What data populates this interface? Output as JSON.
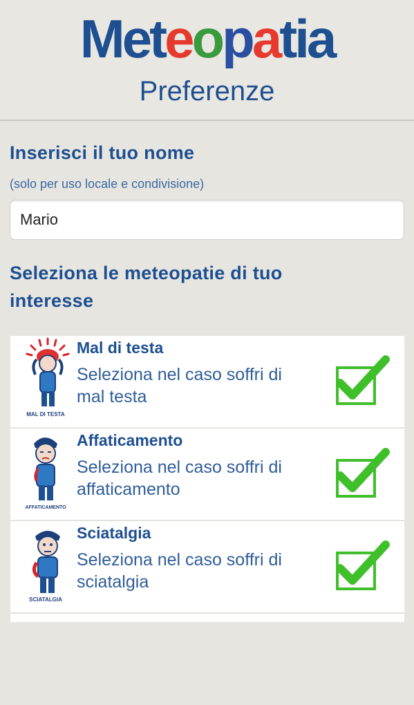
{
  "header": {
    "logo_letters": [
      {
        "char": "M",
        "color": "#1d4f91"
      },
      {
        "char": "e",
        "color": "#1d4f91"
      },
      {
        "char": "t",
        "color": "#1d4f91"
      },
      {
        "char": "e",
        "color": "#e63a2e"
      },
      {
        "char": "o",
        "color": "#3a9a3e"
      },
      {
        "char": "p",
        "color": "#2a4fa0"
      },
      {
        "char": "a",
        "color": "#e63a2e"
      },
      {
        "char": "t",
        "color": "#1d4f91"
      },
      {
        "char": "i",
        "color": "#1d4f91"
      },
      {
        "char": "a",
        "color": "#1d4f91"
      }
    ],
    "subtitle": "Preferenze"
  },
  "name_section": {
    "title": "Inserisci il tuo nome",
    "hint": "(solo per uso locale e condivisione)",
    "value": "Mario"
  },
  "conditions_section": {
    "title_line1": "Seleziona le meteopatie di tuo",
    "title_line2": "interesse",
    "items": [
      {
        "title": "Mal di testa",
        "desc_line1": "Seleziona nel caso soffri di",
        "desc_line2": "mal testa",
        "icon_caption": "MAL DI TESTA",
        "icon": "headache-figure-icon",
        "checked": true
      },
      {
        "title": "Affaticamento",
        "desc_line1": "Seleziona nel caso soffri di",
        "desc_line2": "affaticamento",
        "icon_caption": "AFFATICAMENTO",
        "icon": "fatigue-figure-icon",
        "checked": true
      },
      {
        "title": "Sciatalgia",
        "desc_line1": "Seleziona nel caso soffri di",
        "desc_line2": "sciatalgia",
        "icon_caption": "SCIATALGIA",
        "icon": "sciatica-figure-icon",
        "checked": true
      }
    ]
  },
  "colors": {
    "brand_blue": "#1d4f91",
    "check_green": "#3fbf2a"
  }
}
